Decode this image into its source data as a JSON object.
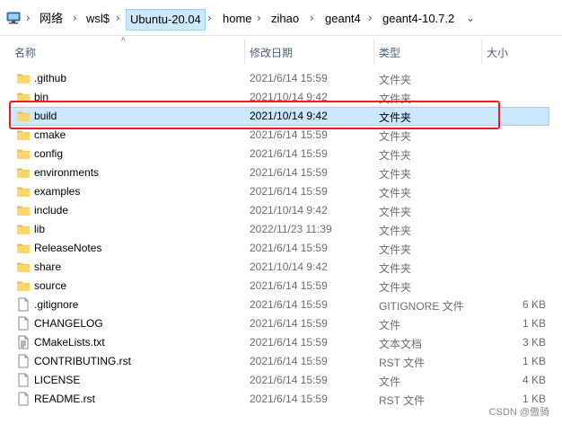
{
  "address_bar": {
    "crumbs": [
      "网络",
      "wsl$",
      "Ubuntu-20.04",
      "home",
      "zihao",
      "geant4",
      "geant4-10.7.2"
    ],
    "separator": "›"
  },
  "columns": {
    "name": "名称",
    "date": "修改日期",
    "type": "类型",
    "size": "大小"
  },
  "files": [
    {
      "name": ".github",
      "date": "2021/6/14 15:59",
      "type": "文件夹",
      "size": "",
      "icon": "folder-icon"
    },
    {
      "name": "bin",
      "date": "2021/10/14 9:42",
      "type": "文件夹",
      "size": "",
      "icon": "folder-icon"
    },
    {
      "name": "build",
      "date": "2021/10/14 9:42",
      "type": "文件夹",
      "size": "",
      "icon": "folder-icon"
    },
    {
      "name": "cmake",
      "date": "2021/6/14 15:59",
      "type": "文件夹",
      "size": "",
      "icon": "folder-icon"
    },
    {
      "name": "config",
      "date": "2021/6/14 15:59",
      "type": "文件夹",
      "size": "",
      "icon": "folder-icon"
    },
    {
      "name": "environments",
      "date": "2021/6/14 15:59",
      "type": "文件夹",
      "size": "",
      "icon": "folder-icon"
    },
    {
      "name": "examples",
      "date": "2021/6/14 15:59",
      "type": "文件夹",
      "size": "",
      "icon": "folder-icon"
    },
    {
      "name": "include",
      "date": "2021/10/14 9:42",
      "type": "文件夹",
      "size": "",
      "icon": "folder-icon"
    },
    {
      "name": "lib",
      "date": "2022/11/23 11:39",
      "type": "文件夹",
      "size": "",
      "icon": "folder-icon"
    },
    {
      "name": "ReleaseNotes",
      "date": "2021/6/14 15:59",
      "type": "文件夹",
      "size": "",
      "icon": "folder-icon"
    },
    {
      "name": "share",
      "date": "2021/10/14 9:42",
      "type": "文件夹",
      "size": "",
      "icon": "folder-icon"
    },
    {
      "name": "source",
      "date": "2021/6/14 15:59",
      "type": "文件夹",
      "size": "",
      "icon": "folder-icon"
    },
    {
      "name": ".gitignore",
      "date": "2021/6/14 15:59",
      "type": "GITIGNORE 文件",
      "size": "6 KB",
      "icon": "file-icon"
    },
    {
      "name": "CHANGELOG",
      "date": "2021/6/14 15:59",
      "type": "文件",
      "size": "1 KB",
      "icon": "file-icon"
    },
    {
      "name": "CMakeLists.txt",
      "date": "2021/6/14 15:59",
      "type": "文本文档",
      "size": "3 KB",
      "icon": "text-file-icon"
    },
    {
      "name": "CONTRIBUTING.rst",
      "date": "2021/6/14 15:59",
      "type": "RST 文件",
      "size": "1 KB",
      "icon": "file-icon"
    },
    {
      "name": "LICENSE",
      "date": "2021/6/14 15:59",
      "type": "文件",
      "size": "4 KB",
      "icon": "file-icon"
    },
    {
      "name": "README.rst",
      "date": "2021/6/14 15:59",
      "type": "RST 文件",
      "size": "1 KB",
      "icon": "file-icon"
    }
  ],
  "selected_index": 2,
  "watermark": "CSDN @傲骑",
  "colors": {
    "selection_bg": "#cce8ff",
    "selection_border": "#99d1ff",
    "highlight_box": "#e8201c",
    "folder_yellow": "#ffd66b",
    "header_text": "#4c607a"
  }
}
